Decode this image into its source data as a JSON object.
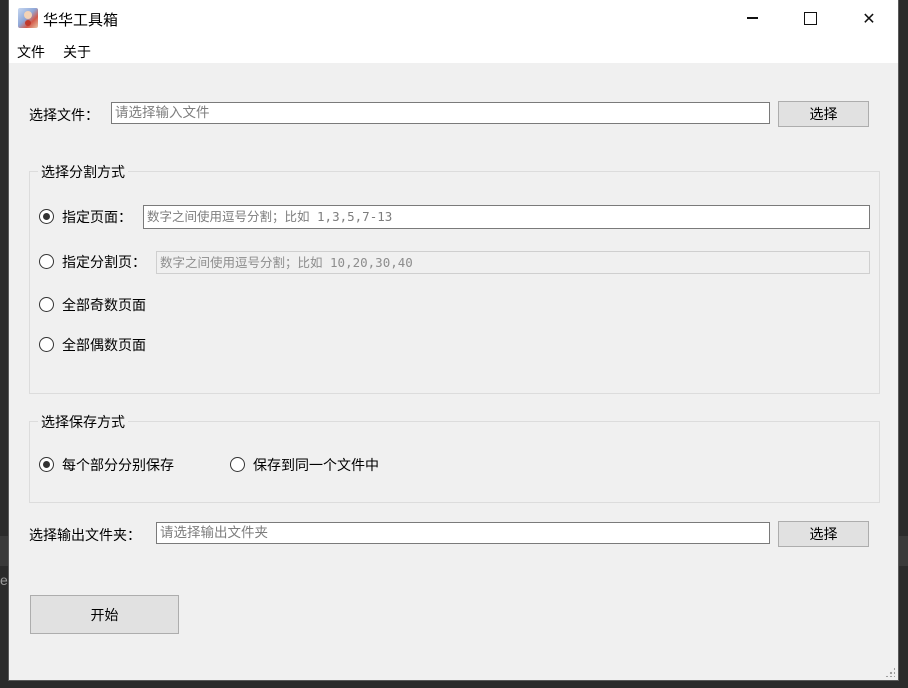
{
  "window": {
    "title": "华华工具箱",
    "controls": {
      "minimize": "—",
      "close": "✕"
    }
  },
  "menu": [
    "文件",
    "关于"
  ],
  "input_file": {
    "label": "选择文件：",
    "placeholder": "请选择输入文件",
    "button": "选择"
  },
  "split_group": {
    "title": "选择分割方式",
    "options": [
      {
        "label": "指定页面：",
        "checked": true,
        "placeholder": "数字之间使用逗号分割；比如 1,3,5,7-13"
      },
      {
        "label": "指定分割页：",
        "checked": false,
        "placeholder": "数字之间使用逗号分割；比如 10,20,30,40"
      },
      {
        "label": "全部奇数页面",
        "checked": false
      },
      {
        "label": "全部偶数页面",
        "checked": false
      }
    ]
  },
  "save_group": {
    "title": "选择保存方式",
    "options": [
      {
        "label": "每个部分分别保存",
        "checked": true
      },
      {
        "label": "保存到同一个文件中",
        "checked": false
      }
    ]
  },
  "output_folder": {
    "label": "选择输出文件夹：",
    "placeholder": "请选择输出文件夹",
    "button": "选择"
  },
  "start_button": "开始",
  "background_fragment": "e"
}
